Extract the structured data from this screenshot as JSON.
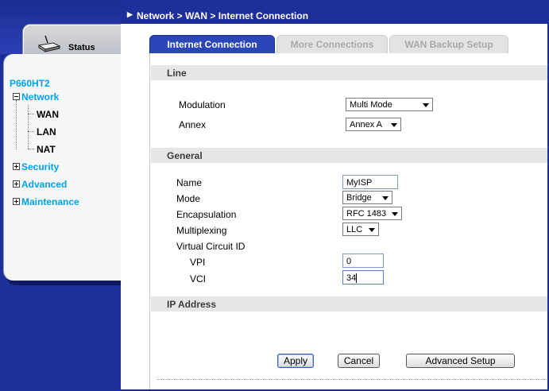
{
  "sidebar": {
    "status_label": "Status",
    "model": "P660HT2",
    "network_label": "Network",
    "network_children": [
      "WAN",
      "LAN",
      "NAT"
    ],
    "security_label": "Security",
    "advanced_label": "Advanced",
    "maintenance_label": "Maintenance",
    "icons": {
      "status": "router-icon",
      "expanded": "minus-box-icon",
      "collapsed": "plus-box-icon"
    }
  },
  "breadcrumb": "Network > WAN > Internet Connection",
  "tabs": [
    {
      "label": "Internet Connection",
      "active": true
    },
    {
      "label": "More Connections",
      "active": false
    },
    {
      "label": "WAN Backup Setup",
      "active": false
    }
  ],
  "line": {
    "title": "Line",
    "modulation_label": "Modulation",
    "modulation_value": "Multi Mode",
    "annex_label": "Annex",
    "annex_value": "Annex A"
  },
  "general": {
    "title": "General",
    "name_label": "Name",
    "name_value": "MyISP",
    "mode_label": "Mode",
    "mode_value": "Bridge",
    "encapsulation_label": "Encapsulation",
    "encapsulation_value": "RFC 1483",
    "multiplexing_label": "Multiplexing",
    "multiplexing_value": "LLC",
    "vc_label": "Virtual Circuit ID",
    "vpi_label": "VPI",
    "vpi_value": "0",
    "vci_label": "VCI",
    "vci_value": "34"
  },
  "ip": {
    "title": "IP Address"
  },
  "buttons": {
    "apply": "Apply",
    "cancel": "Cancel",
    "advanced": "Advanced Setup"
  },
  "colors": {
    "nav_blue": "#1d2f9a",
    "link_cyan": "#00a2e8",
    "tab_active": "#2a46b8"
  }
}
